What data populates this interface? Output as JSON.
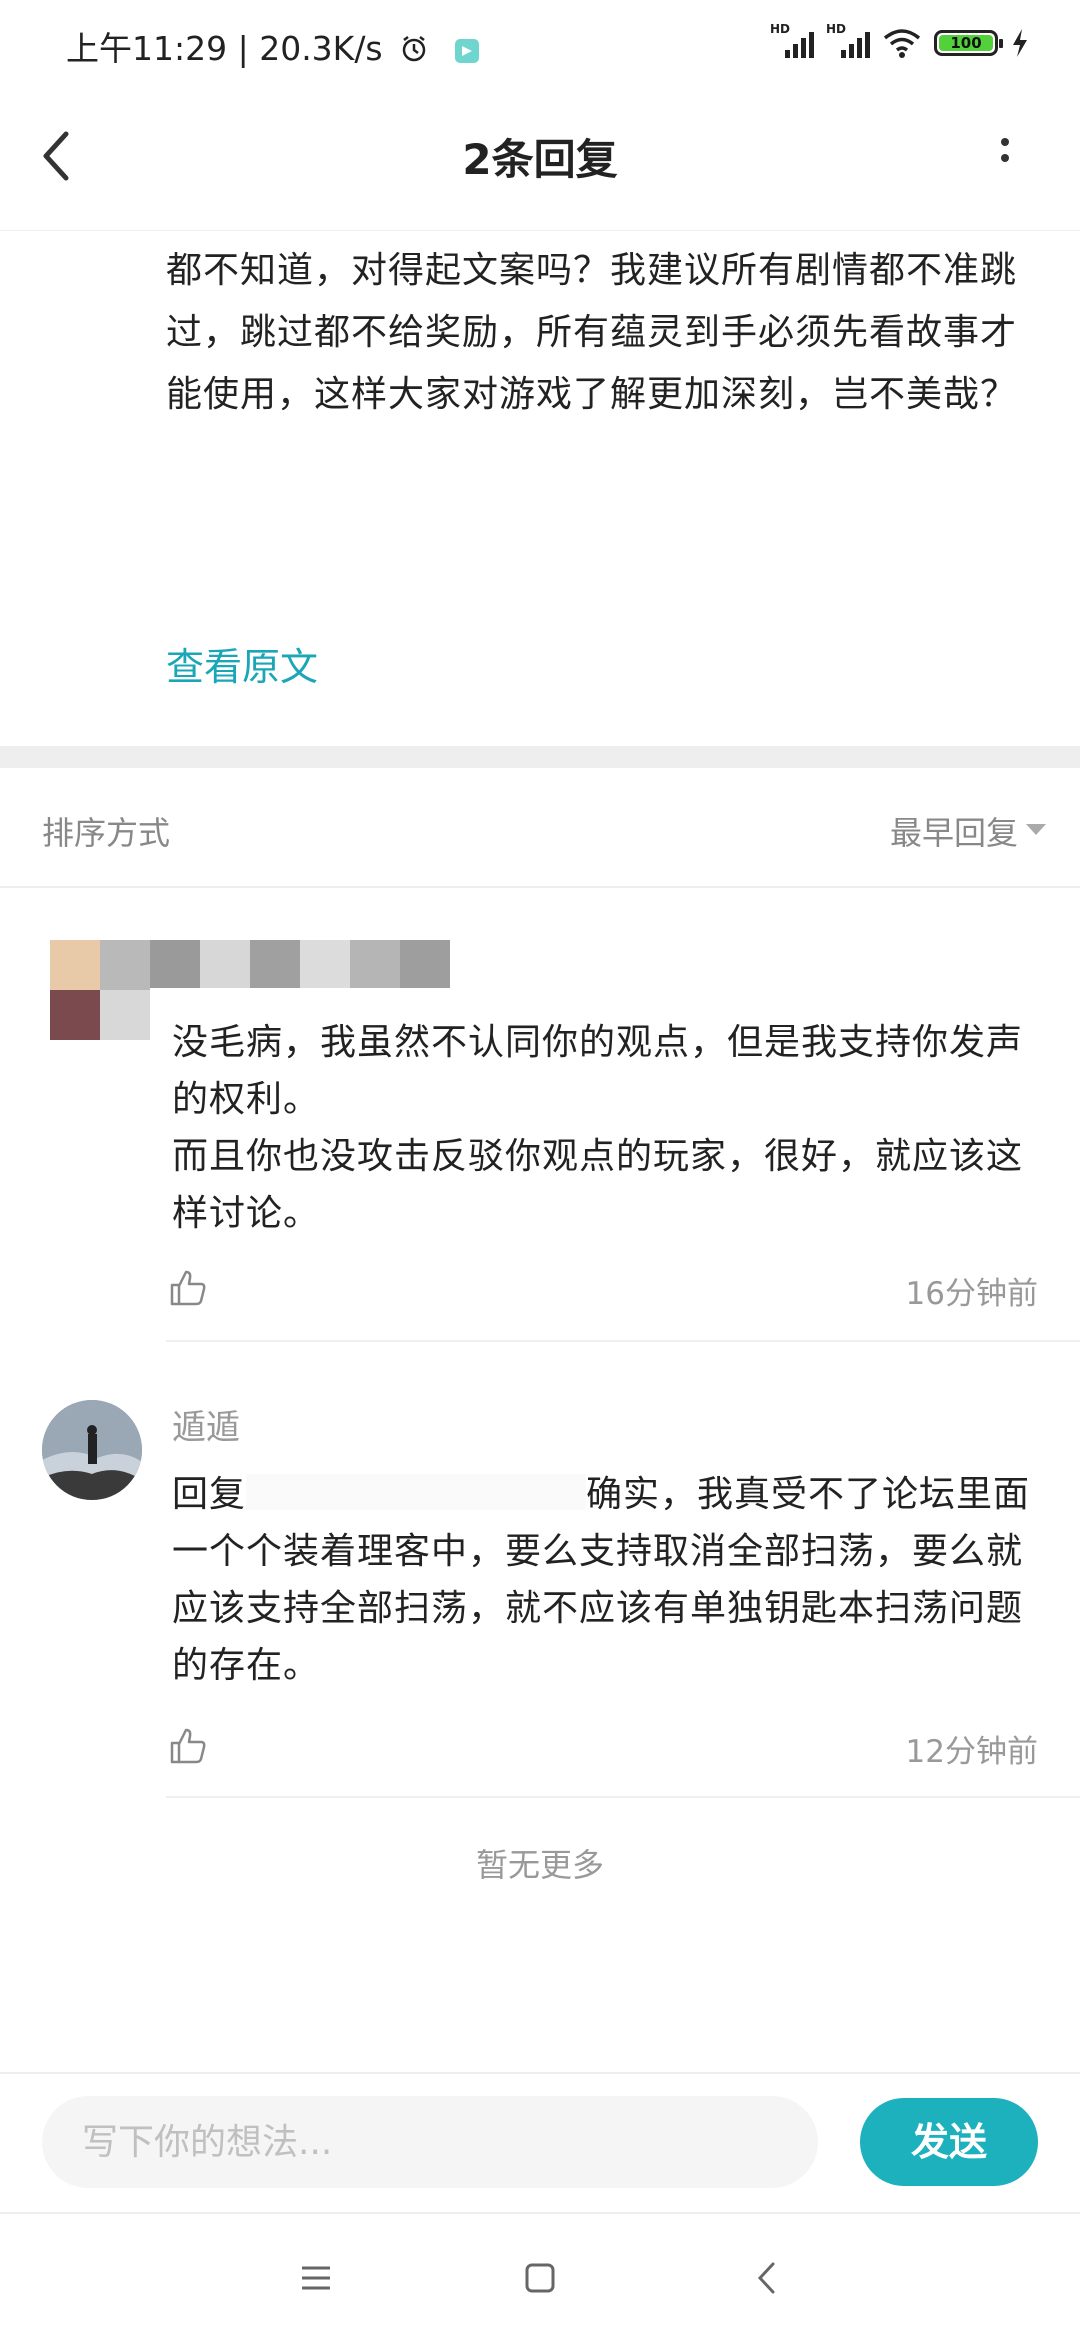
{
  "status_bar": {
    "time_speed": "上午11:29 | 20.3K/s",
    "battery": "100",
    "icons": [
      "alarm-icon",
      "app-notification-icon",
      "hd-signal-icon",
      "hd-signal-icon",
      "wifi-icon",
      "battery-icon",
      "charging-icon"
    ]
  },
  "header": {
    "title": "2条回复",
    "icons": [
      "back-arrow-icon",
      "more-vertical-icon"
    ]
  },
  "post": {
    "text": "都不知道，对得起文案吗？我建议所有剧情都不准跳过，跳过都不给奖励，所有蕴灵到手必须先看故事才能使用，这样大家对游戏了解更加深刻，岂不美哉？",
    "view_original": "查看原文"
  },
  "sort": {
    "label": "排序方式",
    "value": "最早回复"
  },
  "comments": [
    {
      "name": "",
      "body": "没毛病，我虽然不认同你的观点，但是我支持你发声的权利。\n而且你也没攻击反驳你观点的玩家，很好，就应该这样讨论。",
      "time": "16分钟前"
    },
    {
      "name": "遁遁",
      "reply_prefix": "回复",
      "body": "确实，我真受不了论坛里面一个个装着理客中，要么支持取消全部扫荡，要么就应该支持全部扫荡，就不应该有单独钥匙本扫荡问题的存在。",
      "time": "12分钟前"
    }
  ],
  "footer_note": "暂无更多",
  "input": {
    "placeholder": "写下你的想法...",
    "send_label": "发送"
  },
  "colors": {
    "accent": "#1db0bd",
    "link": "#1aa6b7",
    "muted_text": "#999999"
  }
}
